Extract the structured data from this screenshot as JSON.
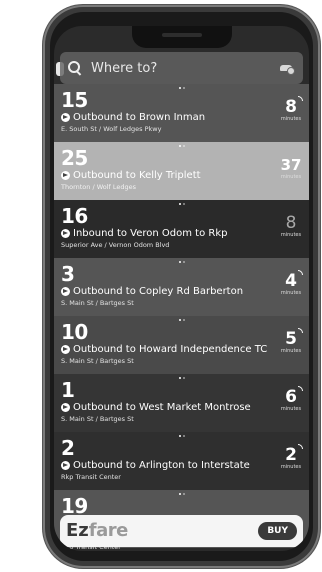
{
  "search": {
    "placeholder": "Where to?"
  },
  "routes": [
    {
      "number": "15",
      "direction": "Outbound to Brown Inman",
      "stop": "E. South St / Wolf Ledges Pkwy",
      "eta": "8",
      "unit": "minutes"
    },
    {
      "number": "25",
      "direction": "Outbound to Kelly Triplett",
      "stop": "Thornton / Wolf Ledges",
      "eta": "37",
      "unit": "minutes"
    },
    {
      "number": "16",
      "direction": "Inbound to Veron Odom to Rkp",
      "stop": "Superior Ave / Vernon Odom Blvd",
      "eta": "8",
      "unit": "minutes"
    },
    {
      "number": "3",
      "direction": "Outbound to Copley Rd Barberton",
      "stop": "S. Main St / Bartges St",
      "eta": "4",
      "unit": "minutes"
    },
    {
      "number": "10",
      "direction": "Outbound to Howard Independence TC",
      "stop": "S. Main St / Bartges St",
      "eta": "5",
      "unit": "minutes"
    },
    {
      "number": "1",
      "direction": "Outbound to West Market Montrose",
      "stop": "S. Main St / Bartges St",
      "eta": "6",
      "unit": "minutes"
    },
    {
      "number": "2",
      "direction": "Outbound to Arlington to Interstate",
      "stop": "Rkp Transit Center",
      "eta": "2",
      "unit": "minutes"
    },
    {
      "number": "19",
      "direction": "",
      "stop": "Rkp Transit Center",
      "eta": "",
      "unit": ""
    }
  ],
  "ad": {
    "logo_ez": "Ez",
    "logo_fare": "fare",
    "buy_label": "BUY"
  },
  "colors": {
    "highlight_row": "#b3b3b3",
    "search_bg": "#646464"
  }
}
